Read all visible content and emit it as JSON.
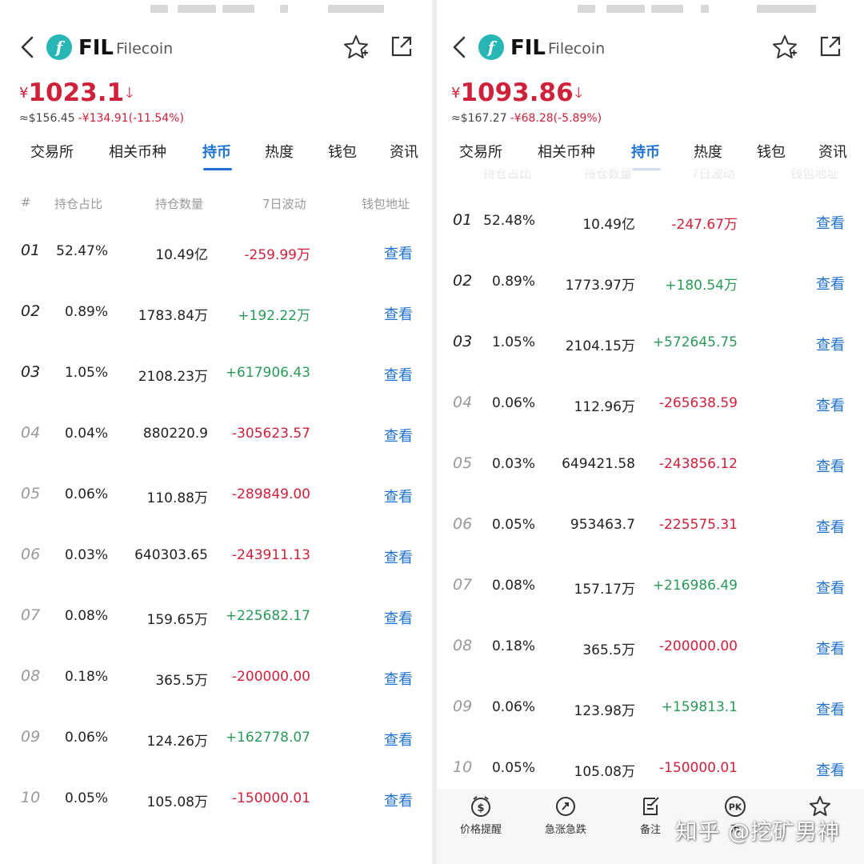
{
  "colors": {
    "accent": "#1f72d2",
    "down": "#d0213b",
    "up": "#2a9a58",
    "logo": "#27b5b5"
  },
  "tabs": [
    "交易所",
    "相关币种",
    "持币",
    "热度",
    "钱包",
    "资讯"
  ],
  "active_tab": "持币",
  "columns": {
    "rank": "#",
    "ratio": "持仓占比",
    "qty": "持仓数量",
    "change": "7日波动",
    "address": "钱包地址"
  },
  "view_label": "查看",
  "panels": [
    {
      "coin": {
        "symbol": "FIL",
        "name": "Filecoin",
        "logo_glyph": "f"
      },
      "price": {
        "currency": "¥",
        "value": "1023.1",
        "usd": "≈$156.45",
        "change": "-¥134.91(-11.54%)"
      },
      "rows": [
        {
          "rank": "01",
          "pct": "52.47%",
          "qty": "10.49亿",
          "chg": "-259.99万",
          "dir": "neg"
        },
        {
          "rank": "02",
          "pct": "0.89%",
          "qty": "1783.84万",
          "chg": "+192.22万",
          "dir": "pos"
        },
        {
          "rank": "03",
          "pct": "1.05%",
          "qty": "2108.23万",
          "chg": "+617906.43",
          "dir": "pos"
        },
        {
          "rank": "04",
          "pct": "0.04%",
          "qty": "880220.9",
          "chg": "-305623.57",
          "dir": "neg"
        },
        {
          "rank": "05",
          "pct": "0.06%",
          "qty": "110.88万",
          "chg": "-289849.00",
          "dir": "neg"
        },
        {
          "rank": "06",
          "pct": "0.03%",
          "qty": "640303.65",
          "chg": "-243911.13",
          "dir": "neg"
        },
        {
          "rank": "07",
          "pct": "0.08%",
          "qty": "159.65万",
          "chg": "+225682.17",
          "dir": "pos"
        },
        {
          "rank": "08",
          "pct": "0.18%",
          "qty": "365.5万",
          "chg": "-200000.00",
          "dir": "neg"
        },
        {
          "rank": "09",
          "pct": "0.06%",
          "qty": "124.26万",
          "chg": "+162778.07",
          "dir": "pos"
        },
        {
          "rank": "10",
          "pct": "0.05%",
          "qty": "105.08万",
          "chg": "-150000.01",
          "dir": "neg"
        }
      ]
    },
    {
      "coin": {
        "symbol": "FIL",
        "name": "Filecoin",
        "logo_glyph": "f"
      },
      "price": {
        "currency": "¥",
        "value": "1093.86",
        "usd": "≈$167.27",
        "change": "-¥68.28(-5.89%)"
      },
      "rows": [
        {
          "rank": "01",
          "pct": "52.48%",
          "qty": "10.49亿",
          "chg": "-247.67万",
          "dir": "neg"
        },
        {
          "rank": "02",
          "pct": "0.89%",
          "qty": "1773.97万",
          "chg": "+180.54万",
          "dir": "pos"
        },
        {
          "rank": "03",
          "pct": "1.05%",
          "qty": "2104.15万",
          "chg": "+572645.75",
          "dir": "pos"
        },
        {
          "rank": "04",
          "pct": "0.06%",
          "qty": "112.96万",
          "chg": "-265638.59",
          "dir": "neg"
        },
        {
          "rank": "05",
          "pct": "0.03%",
          "qty": "649421.58",
          "chg": "-243856.12",
          "dir": "neg"
        },
        {
          "rank": "06",
          "pct": "0.05%",
          "qty": "953463.7",
          "chg": "-225575.31",
          "dir": "neg"
        },
        {
          "rank": "07",
          "pct": "0.08%",
          "qty": "157.17万",
          "chg": "+216986.49",
          "dir": "pos"
        },
        {
          "rank": "08",
          "pct": "0.18%",
          "qty": "365.5万",
          "chg": "-200000.00",
          "dir": "neg"
        },
        {
          "rank": "09",
          "pct": "0.06%",
          "qty": "123.98万",
          "chg": "+159813.1",
          "dir": "pos"
        },
        {
          "rank": "10",
          "pct": "0.05%",
          "qty": "105.08万",
          "chg": "-150000.01",
          "dir": "neg"
        }
      ]
    }
  ],
  "toolbar": [
    {
      "label": "价格提醒",
      "icon": "price-alert-icon"
    },
    {
      "label": "急涨急跌",
      "icon": "surge-icon"
    },
    {
      "label": "备注",
      "icon": "note-icon"
    },
    {
      "label": "币",
      "icon": "pk-icon"
    },
    {
      "label": "",
      "icon": "star-add-icon"
    }
  ],
  "watermark": "知乎 @挖矿男神"
}
